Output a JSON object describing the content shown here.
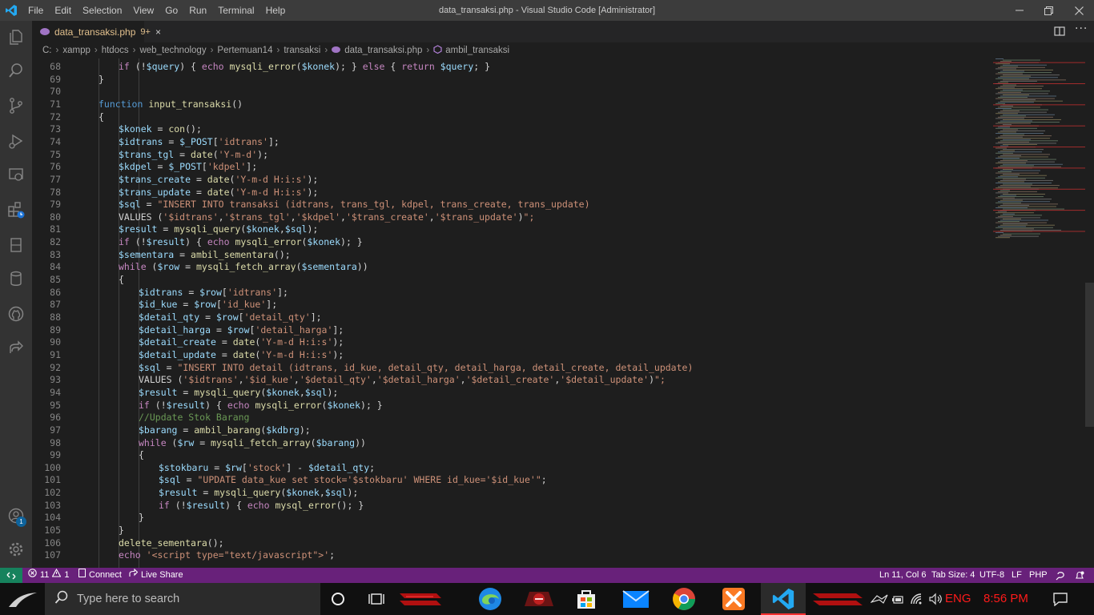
{
  "titlebar": {
    "menu": [
      "File",
      "Edit",
      "Selection",
      "View",
      "Go",
      "Run",
      "Terminal",
      "Help"
    ],
    "title": "data_transaksi.php - Visual Studio Code [Administrator]"
  },
  "tab": {
    "label": "data_transaksi.php",
    "badge": "9+",
    "close": "×"
  },
  "breadcrumb": [
    "C:",
    "xampp",
    "htdocs",
    "web_technology",
    "Pertemuan14",
    "transaksi",
    "data_transaksi.php",
    "ambil_transaksi"
  ],
  "editor": {
    "lines": [
      {
        "n": "68",
        "indent": 2,
        "t": "if (!$query) { echo mysqli_error($konek); } else { return $query; }"
      },
      {
        "n": "69",
        "indent": 1,
        "t": "}"
      },
      {
        "n": "70",
        "indent": 0,
        "t": ""
      },
      {
        "n": "71",
        "indent": 1,
        "t": "function input_transaksi()"
      },
      {
        "n": "72",
        "indent": 1,
        "t": "{"
      },
      {
        "n": "73",
        "indent": 2,
        "t": "$konek = con();"
      },
      {
        "n": "74",
        "indent": 2,
        "t": "$idtrans = $_POST['idtrans'];"
      },
      {
        "n": "75",
        "indent": 2,
        "t": "$trans_tgl = date('Y-m-d');"
      },
      {
        "n": "76",
        "indent": 2,
        "t": "$kdpel = $_POST['kdpel'];"
      },
      {
        "n": "77",
        "indent": 2,
        "t": "$trans_create = date('Y-m-d H:i:s');"
      },
      {
        "n": "78",
        "indent": 2,
        "t": "$trans_update = date('Y-m-d H:i:s');"
      },
      {
        "n": "79",
        "indent": 2,
        "t": "$sql = \"INSERT INTO transaksi (idtrans, trans_tgl, kdpel, trans_create, trans_update)"
      },
      {
        "n": "80",
        "indent": 2,
        "t": "VALUES ('$idtrans','$trans_tgl','$kdpel','$trans_create','$trans_update')\";"
      },
      {
        "n": "81",
        "indent": 2,
        "t": "$result = mysqli_query($konek,$sql);"
      },
      {
        "n": "82",
        "indent": 2,
        "t": "if (!$result) { echo mysqli_error($konek); }"
      },
      {
        "n": "83",
        "indent": 2,
        "t": "$sementara = ambil_sementara();"
      },
      {
        "n": "84",
        "indent": 2,
        "t": "while ($row = mysqli_fetch_array($sementara))"
      },
      {
        "n": "85",
        "indent": 2,
        "t": "{"
      },
      {
        "n": "86",
        "indent": 3,
        "t": "$idtrans = $row['idtrans'];"
      },
      {
        "n": "87",
        "indent": 3,
        "t": "$id_kue = $row['id_kue'];"
      },
      {
        "n": "88",
        "indent": 3,
        "t": "$detail_qty = $row['detail_qty'];"
      },
      {
        "n": "89",
        "indent": 3,
        "t": "$detail_harga = $row['detail_harga'];"
      },
      {
        "n": "90",
        "indent": 3,
        "t": "$detail_create = date('Y-m-d H:i:s');"
      },
      {
        "n": "91",
        "indent": 3,
        "t": "$detail_update = date('Y-m-d H:i:s');"
      },
      {
        "n": "92",
        "indent": 3,
        "t": "$sql = \"INSERT INTO detail (idtrans, id_kue, detail_qty, detail_harga, detail_create, detail_update)"
      },
      {
        "n": "93",
        "indent": 3,
        "t": "VALUES ('$idtrans','$id_kue','$detail_qty','$detail_harga','$detail_create','$detail_update')\";"
      },
      {
        "n": "94",
        "indent": 3,
        "t": "$result = mysqli_query($konek,$sql);"
      },
      {
        "n": "95",
        "indent": 3,
        "t": "if (!$result) { echo mysqli_error($konek); }"
      },
      {
        "n": "96",
        "indent": 3,
        "t": "//Update Stok Barang"
      },
      {
        "n": "97",
        "indent": 3,
        "t": "$barang = ambil_barang($kdbrg);"
      },
      {
        "n": "98",
        "indent": 3,
        "t": "while ($rw = mysqli_fetch_array($barang))"
      },
      {
        "n": "99",
        "indent": 3,
        "t": "{"
      },
      {
        "n": "100",
        "indent": 4,
        "t": "$stokbaru = $rw['stock'] - $detail_qty;"
      },
      {
        "n": "101",
        "indent": 4,
        "t": "$sql = \"UPDATE data_kue set stock='$stokbaru' WHERE id_kue='$id_kue'\";"
      },
      {
        "n": "102",
        "indent": 4,
        "t": "$result = mysqli_query($konek,$sql);"
      },
      {
        "n": "103",
        "indent": 4,
        "t": "if (!$result) { echo mysql_error(); }"
      },
      {
        "n": "104",
        "indent": 3,
        "t": "}"
      },
      {
        "n": "105",
        "indent": 2,
        "t": "}"
      },
      {
        "n": "106",
        "indent": 2,
        "t": "delete_sementara();"
      },
      {
        "n": "107",
        "indent": 2,
        "t": "echo '<script type=\"text/javascript\">';"
      }
    ]
  },
  "statusbar": {
    "errors": "11",
    "warnings": "1",
    "connect": "Connect",
    "live_share": "Live Share",
    "position": "Ln 11, Col 6",
    "tab_size": "Tab Size: 4",
    "encoding": "UTF-8",
    "eol": "LF",
    "language": "PHP"
  },
  "accounts_badge": "1",
  "taskbar": {
    "search_placeholder": "Type here to search",
    "language": "ENG",
    "clock": "8:56 PM"
  },
  "colors": {
    "keyword": "#569cd6",
    "control": "#c586c0",
    "variable": "#9cdcfe",
    "function": "#dcdcaa",
    "string": "#ce9178",
    "comment": "#6a9955",
    "statusbar": "#68217a",
    "tray_text": "#ff1a1a"
  }
}
